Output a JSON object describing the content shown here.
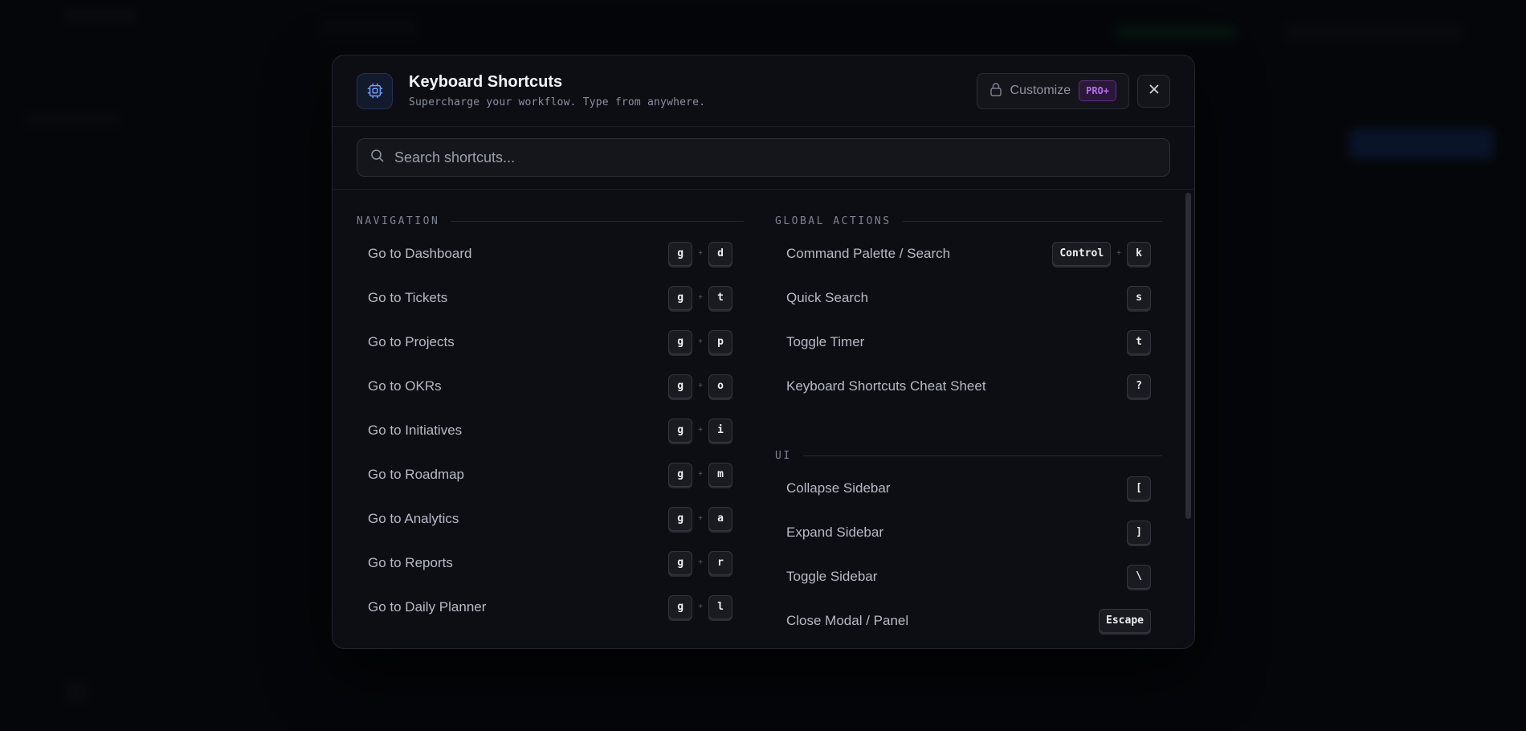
{
  "modal": {
    "title": "Keyboard Shortcuts",
    "subtitle": "Supercharge your workflow. Type from anywhere.",
    "customize_label": "Customize",
    "pro_badge": "PRO+",
    "search_placeholder": "Search shortcuts...",
    "icons": {
      "header": "chip-icon",
      "lock": "lock-icon",
      "close": "close-icon",
      "search": "search-icon"
    }
  },
  "colors": {
    "accent": "#3b82f6",
    "pro": "#b86cf5",
    "background": "#0d0e13"
  },
  "sections": {
    "navigation": {
      "label": "NAVIGATION",
      "items": [
        {
          "label": "Go to Dashboard",
          "keys": [
            "g",
            "d"
          ]
        },
        {
          "label": "Go to Tickets",
          "keys": [
            "g",
            "t"
          ]
        },
        {
          "label": "Go to Projects",
          "keys": [
            "g",
            "p"
          ]
        },
        {
          "label": "Go to OKRs",
          "keys": [
            "g",
            "o"
          ]
        },
        {
          "label": "Go to Initiatives",
          "keys": [
            "g",
            "i"
          ]
        },
        {
          "label": "Go to Roadmap",
          "keys": [
            "g",
            "m"
          ]
        },
        {
          "label": "Go to Analytics",
          "keys": [
            "g",
            "a"
          ]
        },
        {
          "label": "Go to Reports",
          "keys": [
            "g",
            "r"
          ]
        },
        {
          "label": "Go to Daily Planner",
          "keys": [
            "g",
            "l"
          ]
        }
      ]
    },
    "global_actions": {
      "label": "GLOBAL ACTIONS",
      "items": [
        {
          "label": "Command Palette / Search",
          "keys": [
            "Control",
            "k"
          ]
        },
        {
          "label": "Quick Search",
          "keys": [
            "s"
          ]
        },
        {
          "label": "Toggle Timer",
          "keys": [
            "t"
          ]
        },
        {
          "label": "Keyboard Shortcuts Cheat Sheet",
          "keys": [
            "?"
          ]
        }
      ]
    },
    "ui": {
      "label": "UI",
      "items": [
        {
          "label": "Collapse Sidebar",
          "keys": [
            "["
          ]
        },
        {
          "label": "Expand Sidebar",
          "keys": [
            "]"
          ]
        },
        {
          "label": "Toggle Sidebar",
          "keys": [
            "\\"
          ]
        },
        {
          "label": "Close Modal / Panel",
          "keys": [
            "Escape"
          ]
        }
      ]
    }
  }
}
